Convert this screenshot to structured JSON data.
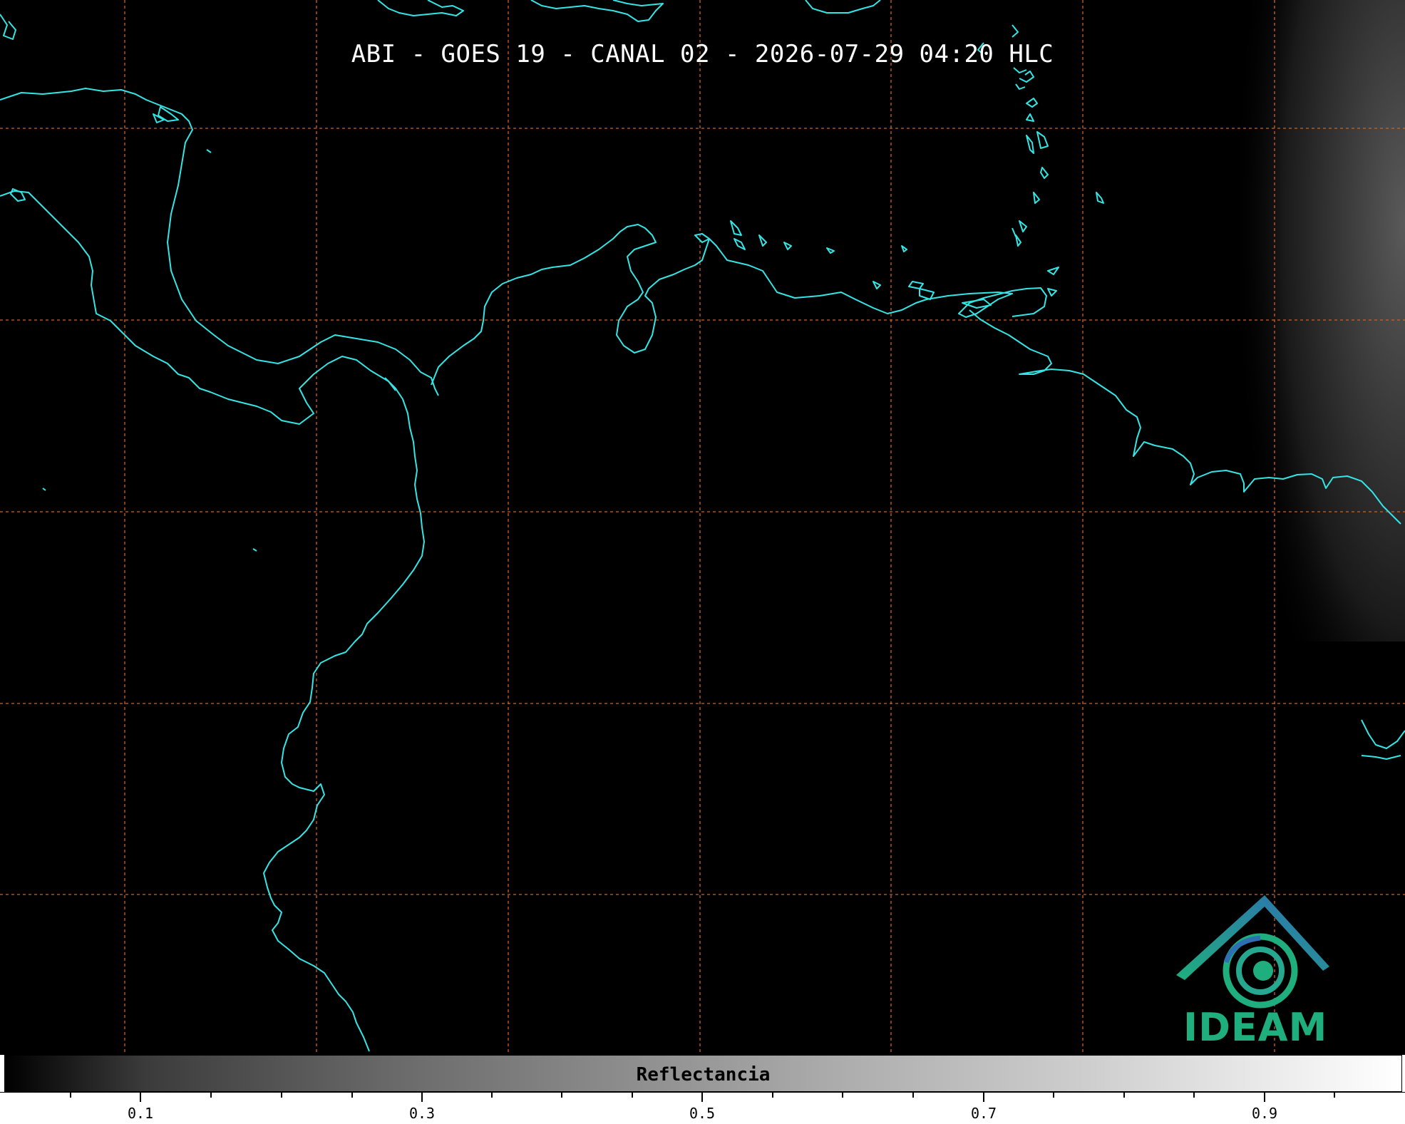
{
  "title": "ABI - GOES 19 - CANAL 02 - 2026-07-29 04:20 HLC",
  "colorbar": {
    "label": "Reflectancia",
    "tick_labels": [
      "0.1",
      "0.3",
      "0.5",
      "0.7",
      "0.9"
    ]
  },
  "logo": {
    "text": "IDEAM"
  },
  "colors": {
    "coastline": "#33e5e5",
    "gridline": "#c8642a",
    "background": "#000000",
    "logo_green": "#1fae7e",
    "logo_blue": "#2e6fb3"
  }
}
